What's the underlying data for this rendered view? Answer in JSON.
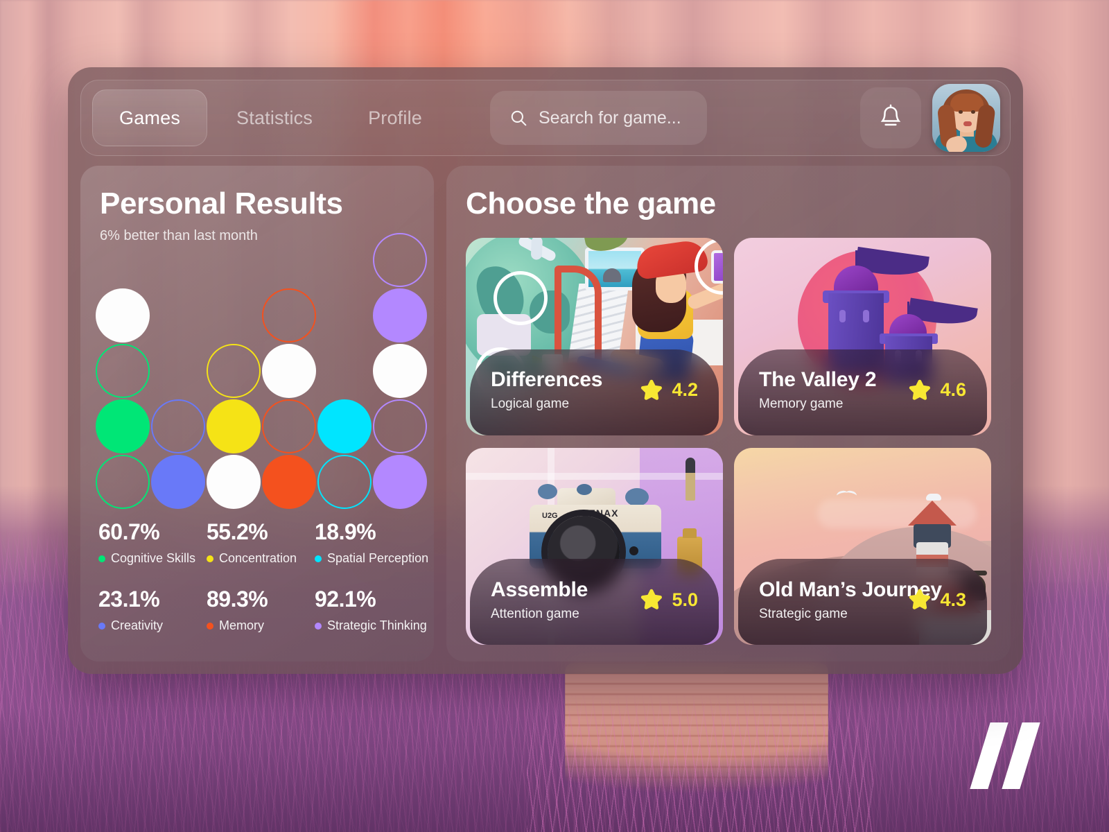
{
  "nav": {
    "tabs": [
      {
        "label": "Games",
        "active": true
      },
      {
        "label": "Statistics",
        "active": false
      },
      {
        "label": "Profile",
        "active": false
      }
    ]
  },
  "search": {
    "placeholder": "Search for game...",
    "value": "",
    "icon": "search-icon"
  },
  "notifications": {
    "icon": "bell-icon"
  },
  "account": {
    "avatar_alt": "user-avatar"
  },
  "results": {
    "title": "Personal Results",
    "subtitle": "6% better than last month",
    "stats": [
      {
        "value": "60.7%",
        "label": "Cognitive Skills",
        "color": "#00e676"
      },
      {
        "value": "55.2%",
        "label": "Concentration",
        "color": "#f5e316"
      },
      {
        "value": "18.9%",
        "label": "Spatial Perception",
        "color": "#00e5ff"
      },
      {
        "value": "23.1%",
        "label": "Creativity",
        "color": "#6979f8"
      },
      {
        "value": "89.3%",
        "label": "Memory",
        "color": "#f4511e"
      },
      {
        "value": "92.1%",
        "label": "Strategic Thinking",
        "color": "#b388ff"
      }
    ]
  },
  "chart_data": {
    "type": "bar",
    "title": "Personal Results",
    "subtitle": "6% better than last month",
    "render": "dot-matrix",
    "xlabel": "",
    "ylabel": "",
    "ylim": [
      0,
      100
    ],
    "rows": 5,
    "dot_value": 20,
    "categories": [
      "Cognitive Skills",
      "Concentration",
      "Spatial Perception",
      "Creativity",
      "Memory",
      "Strategic Thinking"
    ],
    "values": [
      60.7,
      55.2,
      18.9,
      23.1,
      89.3,
      92.1
    ],
    "colors": [
      "#00e676",
      "#f5e316",
      "#00e5ff",
      "#6979f8",
      "#f4511e",
      "#b388ff"
    ],
    "columns": [
      {
        "name": "Cognitive Skills",
        "color": "#00e676",
        "value": 60.7,
        "cells": [
          "none",
          "white",
          "outline",
          "solid",
          "outline"
        ]
      },
      {
        "name": "Creativity",
        "color": "#6979f8",
        "value": 23.1,
        "cells": [
          "none",
          "none",
          "none",
          "outline",
          "solid"
        ]
      },
      {
        "name": "Concentration",
        "color": "#f5e316",
        "value": 55.2,
        "cells": [
          "none",
          "none",
          "outline",
          "solid",
          "white"
        ]
      },
      {
        "name": "Memory",
        "color": "#f4511e",
        "value": 89.3,
        "cells": [
          "none",
          "outline",
          "white",
          "outline",
          "solid"
        ]
      },
      {
        "name": "Spatial Perception",
        "color": "#00e5ff",
        "value": 18.9,
        "cells": [
          "none",
          "none",
          "none",
          "solid",
          "outline"
        ]
      },
      {
        "name": "Strategic Thinking",
        "color": "#b388ff",
        "value": 92.1,
        "cells": [
          "outline",
          "solid",
          "white",
          "outline",
          "solid"
        ]
      }
    ]
  },
  "games": {
    "title": "Choose the game",
    "star_icon": "star-icon",
    "cards": [
      {
        "name": "Differences",
        "genre": "Logical game",
        "rating": "4.2",
        "art": "hidden-object-room-scene"
      },
      {
        "name": "The Valley 2",
        "genre": "Memory game",
        "rating": "4.6",
        "art": "purple-domed-towers-sunset"
      },
      {
        "name": "Assemble",
        "genre": "Attention game",
        "rating": "5.0",
        "art": "vintage-lenax-u2g-camera"
      },
      {
        "name": "Old Man’s Journey",
        "genre": "Strategic game",
        "rating": "4.3",
        "art": "lighthouse-on-hills"
      }
    ]
  },
  "watermark": {
    "name": "double-slash-logo"
  }
}
